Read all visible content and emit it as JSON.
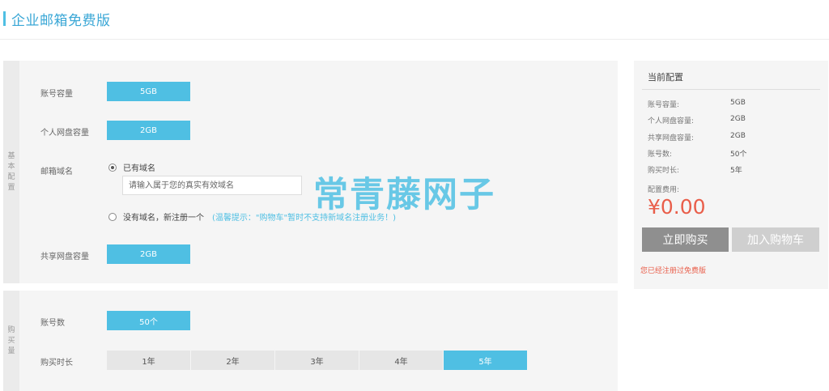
{
  "page": {
    "title": "企业邮箱免费版"
  },
  "basic": {
    "section_label": [
      "基",
      "本",
      "配",
      "置"
    ],
    "account_capacity": {
      "label": "账号容量",
      "value": "5GB"
    },
    "personal_disk": {
      "label": "个人网盘容量",
      "value": "2GB"
    },
    "mail_domain": {
      "label": "邮箱域名",
      "option_have": "已有域名",
      "input_placeholder": "请输入属于您的真实有效域名",
      "option_none": "没有域名，新注册一个",
      "hint": "(温馨提示：\"购物车\"暂时不支持新域名注册业务！)",
      "selected": "have"
    },
    "shared_disk": {
      "label": "共享网盘容量",
      "value": "2GB"
    }
  },
  "buy": {
    "section_label": [
      "购",
      "买",
      "量"
    ],
    "account_count": {
      "label": "账号数",
      "value": "50个"
    },
    "duration": {
      "label": "购买时长",
      "options": [
        "1年",
        "2年",
        "3年",
        "4年",
        "5年"
      ],
      "selected": "5年"
    }
  },
  "summary": {
    "title": "当前配置",
    "rows": [
      {
        "key": "账号容量:",
        "value": "5GB"
      },
      {
        "key": "个人网盘容量:",
        "value": "2GB"
      },
      {
        "key": "共享网盘容量:",
        "value": "2GB"
      },
      {
        "key": "账号数:",
        "value": "50个"
      },
      {
        "key": "购买时长:",
        "value": "5年"
      }
    ],
    "fee_label": "配置费用:",
    "price": "¥0.00",
    "buy_button": "立即购买",
    "cart_button": "加入购物车",
    "notice": "您已经注册过免费版"
  },
  "watermark": "常青藤网子",
  "colors": {
    "accent": "#4fbfe3",
    "price": "#e95e4a",
    "buy_button": "#8f8f8f",
    "cart_button": "#cfcfcf"
  }
}
